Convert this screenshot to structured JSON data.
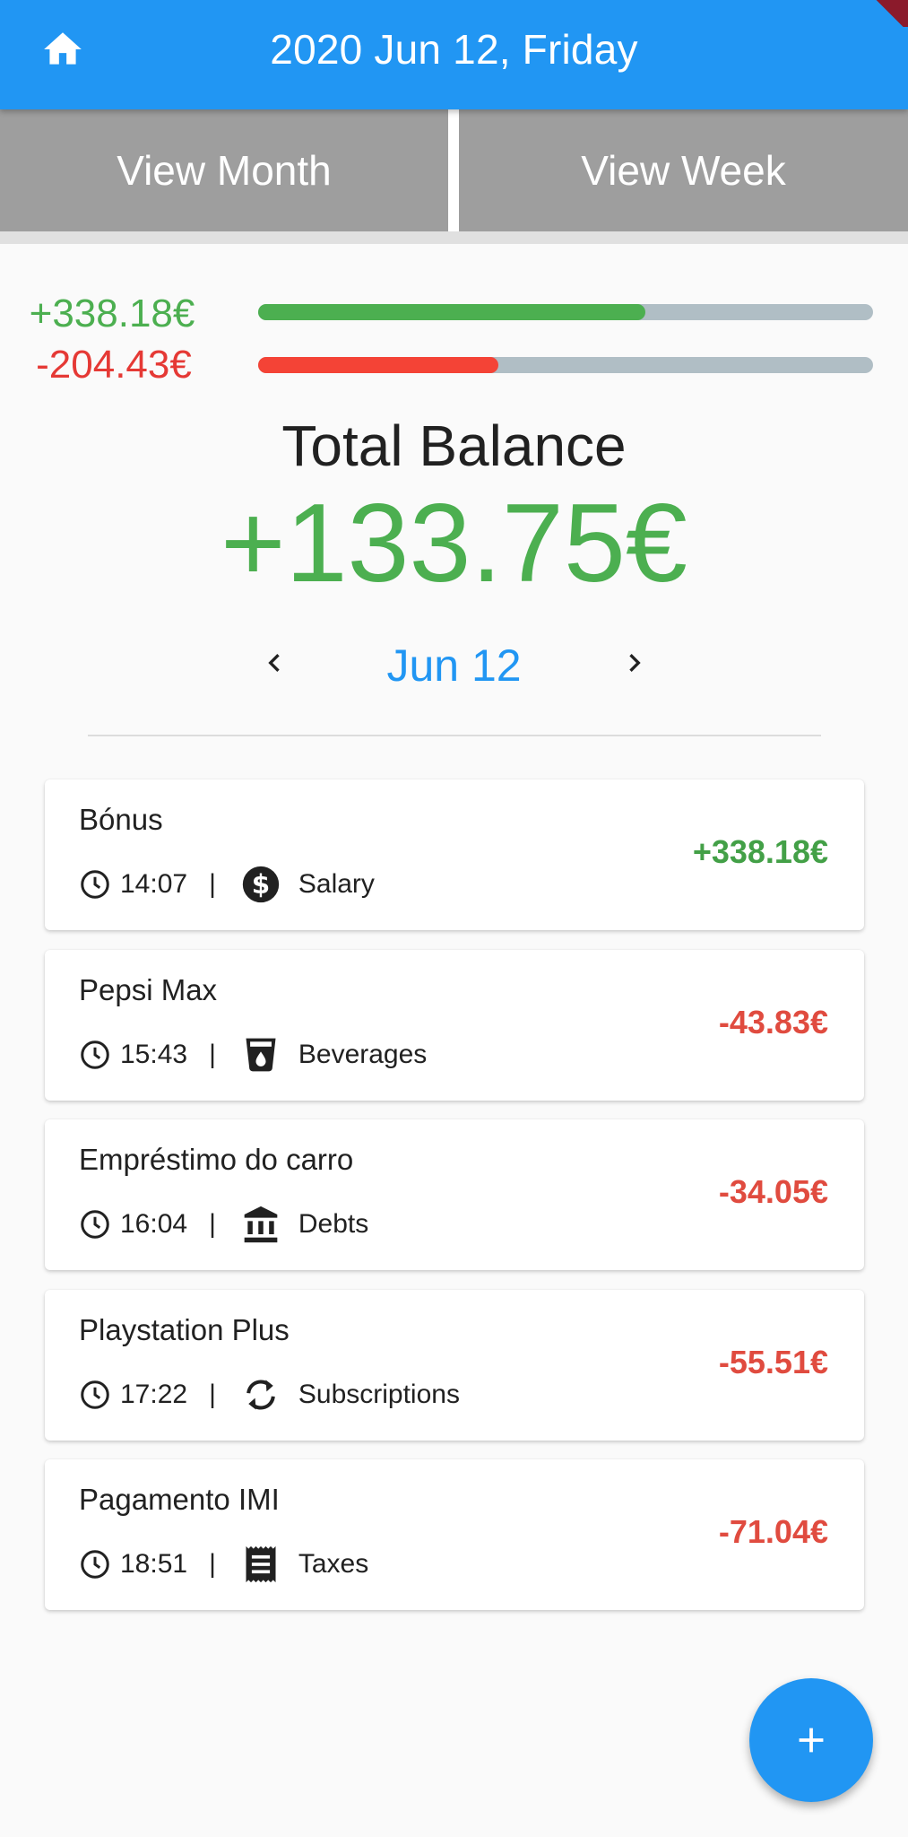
{
  "appbar": {
    "title": "2020 Jun 12, Friday",
    "color": "#2196f3"
  },
  "tabs": {
    "month_label": "View Month",
    "week_label": "View Week"
  },
  "summary": {
    "income": "+338.18€",
    "income_progress": 0.63,
    "expense": "-204.43€",
    "expense_progress": 0.39,
    "income_color": "#4caf50",
    "expense_color": "#f44336"
  },
  "balance": {
    "label": "Total Balance",
    "value": "+133.75€"
  },
  "date_nav": {
    "date": "Jun 12"
  },
  "transactions": [
    {
      "name": "Bónus",
      "time": "14:07",
      "separator": "|",
      "category": "Salary",
      "icon": "dollar-circle-icon",
      "amount": "+338.18€"
    },
    {
      "name": "Pepsi Max",
      "time": "15:43",
      "separator": "|",
      "category": "Beverages",
      "icon": "cup-icon",
      "amount": "-43.83€"
    },
    {
      "name": "Empréstimo do carro",
      "time": "16:04",
      "separator": "|",
      "category": "Debts",
      "icon": "bank-icon",
      "amount": "-34.05€"
    },
    {
      "name": "Playstation Plus",
      "time": "17:22",
      "separator": "|",
      "category": "Subscriptions",
      "icon": "sync-icon",
      "amount": "-55.51€"
    },
    {
      "name": "Pagamento IMI",
      "time": "18:51",
      "separator": "|",
      "category": "Taxes",
      "icon": "receipt-icon",
      "amount": "-71.04€"
    }
  ],
  "fab": {
    "icon": "plus-icon"
  }
}
